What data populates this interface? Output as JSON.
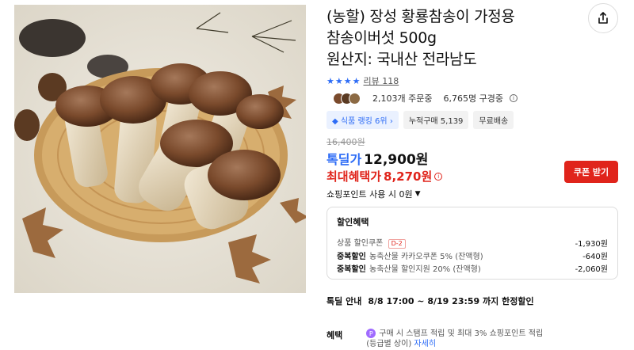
{
  "product": {
    "title_lines": [
      "(농할) 장성 황룡참송이 가정용",
      "참송이버섯 500g",
      "원산지: 국내산 전라남도"
    ],
    "rating_stars": 4,
    "review_label": "리뷰 118",
    "orders_text": "2,103개 주문중",
    "viewers_text": "6,765명 구경중",
    "tags": [
      "식품 랭킹 6위",
      "누적구매 5,139",
      "무료배송"
    ],
    "rank_tag_icon": "rank-icon",
    "price_original": "16,400원",
    "price_badge": "톡딜가",
    "price_main": "12,900원",
    "benefit_label": "최대혜택가",
    "benefit_value": "8,270원",
    "coupon_button": "쿠폰 받기",
    "points_label": "쇼핑포인트 사용 시 0원",
    "accent_color": "#2d6cf6",
    "sale_color": "#e0241b"
  },
  "discount": {
    "title": "할인혜택",
    "rows": [
      {
        "bold": "",
        "text": "상품 할인쿠폰",
        "badge": "D-2",
        "amount": "-1,930원"
      },
      {
        "bold": "중복할인",
        "text": "농축산물 카카오쿠폰 5% (잔액형)",
        "badge": "",
        "amount": "-640원"
      },
      {
        "bold": "중복할인",
        "text": "농축산물 할인지원 20% (잔액형)",
        "badge": "",
        "amount": "-2,060원"
      }
    ]
  },
  "sale_notice": {
    "label": "톡딜 안내",
    "text": "8/8 17:00 ~ 8/19 23:59 까지 한정할인"
  },
  "benefits": {
    "label": "혜택",
    "icon": "P",
    "line1": "구매 시 스탬프 적립 및 최대 3% 쇼핑포인트 적립",
    "line2": "(등급별 상이)",
    "link": "자세히"
  }
}
